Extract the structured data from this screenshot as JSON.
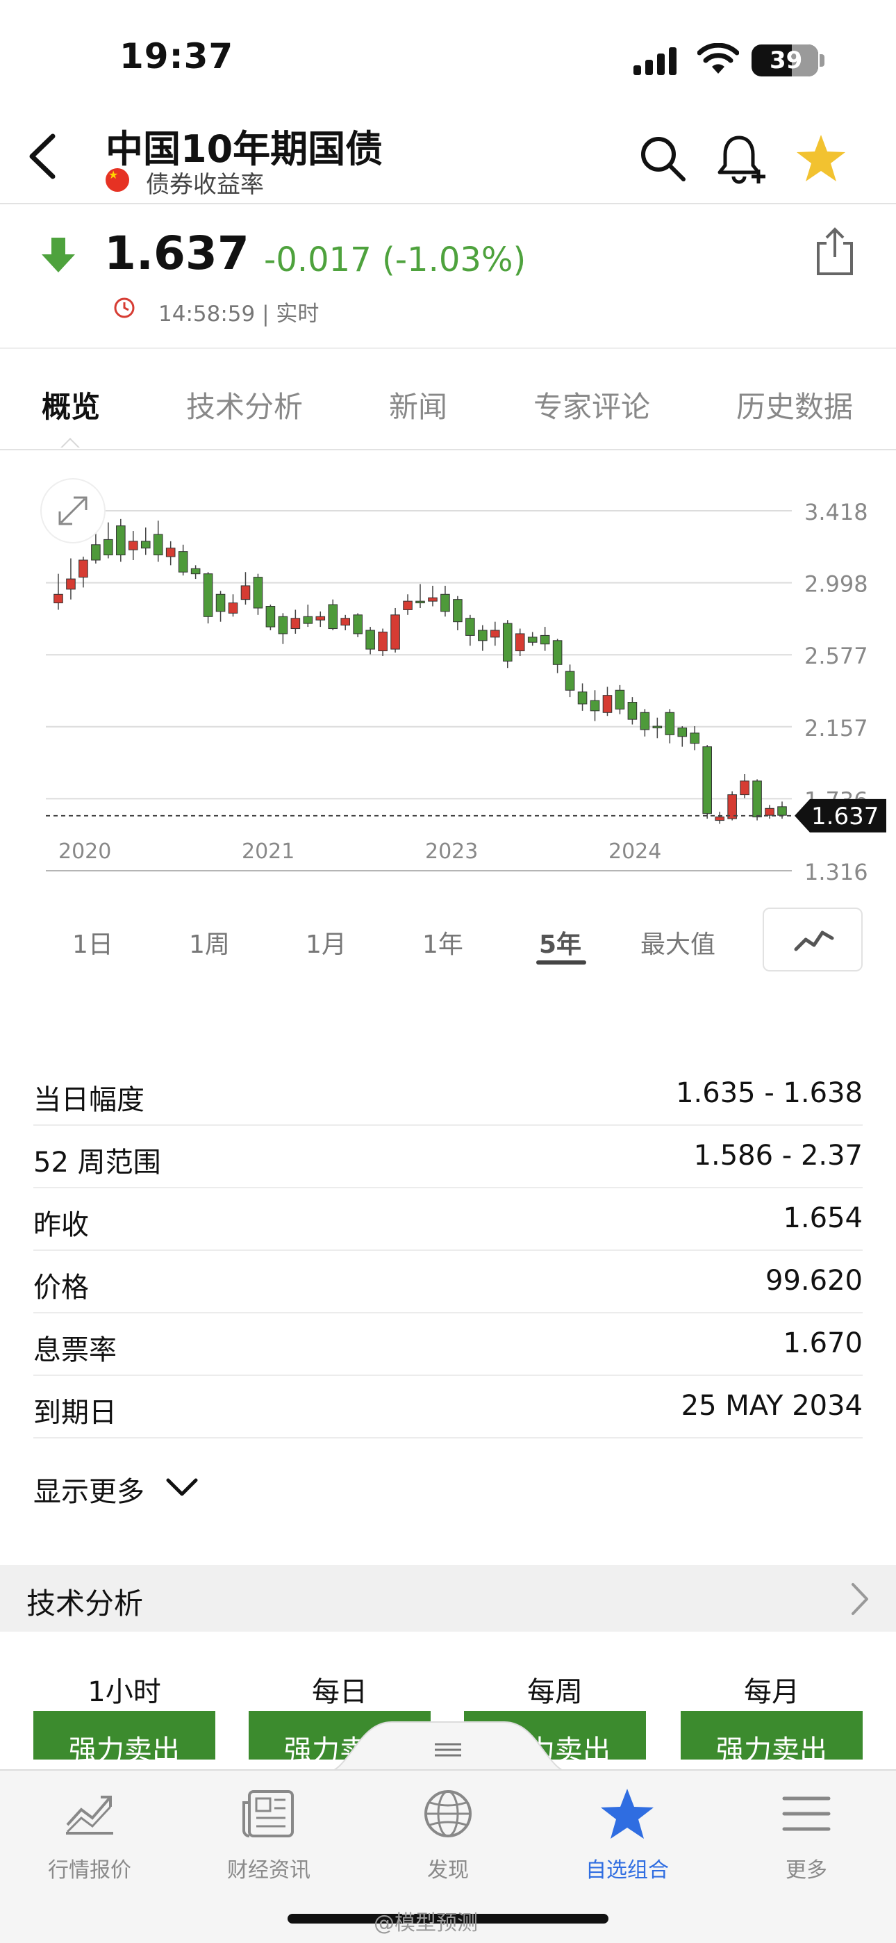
{
  "status_bar": {
    "time": "19:37",
    "battery": "39"
  },
  "header": {
    "title": "中国10年期国债",
    "subtitle": "债券收益率",
    "icons": [
      "chevron-left-icon",
      "search-icon",
      "bell-plus-icon",
      "star-icon"
    ],
    "star_color": "#f2c230"
  },
  "quote": {
    "price": "1.637",
    "change": "-0.017 (-1.03%)",
    "timestamp": "14:58:59 | 实时",
    "change_color": "#4ea23d"
  },
  "tabs": [
    {
      "label": "概览",
      "active": true
    },
    {
      "label": "技术分析",
      "active": false
    },
    {
      "label": "新闻",
      "active": false
    },
    {
      "label": "专家评论",
      "active": false
    },
    {
      "label": "历史数据",
      "active": false
    }
  ],
  "chart_data": {
    "type": "candlestick",
    "x_tick_labels": [
      "2020",
      "2021",
      "2023",
      "2024"
    ],
    "y_tick_labels": [
      "3.418",
      "2.998",
      "2.577",
      "2.157",
      "1.736",
      "1.316"
    ],
    "ylim": [
      1.316,
      3.418
    ],
    "current_value": 1.637,
    "current_label": "1.637",
    "up_color": "#d63c33",
    "down_color": "#4e9a3a",
    "candles": [
      {
        "o": 2.88,
        "h": 3.05,
        "l": 2.84,
        "c": 2.93
      },
      {
        "o": 2.96,
        "h": 3.14,
        "l": 2.9,
        "c": 3.02
      },
      {
        "o": 3.03,
        "h": 3.15,
        "l": 2.97,
        "c": 3.13
      },
      {
        "o": 3.22,
        "h": 3.32,
        "l": 3.11,
        "c": 3.13
      },
      {
        "o": 3.25,
        "h": 3.35,
        "l": 3.14,
        "c": 3.16
      },
      {
        "o": 3.33,
        "h": 3.37,
        "l": 3.12,
        "c": 3.16
      },
      {
        "o": 3.19,
        "h": 3.3,
        "l": 3.13,
        "c": 3.24
      },
      {
        "o": 3.24,
        "h": 3.32,
        "l": 3.16,
        "c": 3.2
      },
      {
        "o": 3.28,
        "h": 3.36,
        "l": 3.12,
        "c": 3.16
      },
      {
        "o": 3.15,
        "h": 3.24,
        "l": 3.1,
        "c": 3.2
      },
      {
        "o": 3.18,
        "h": 3.22,
        "l": 3.04,
        "c": 3.06
      },
      {
        "o": 3.08,
        "h": 3.1,
        "l": 3.02,
        "c": 3.05
      },
      {
        "o": 3.05,
        "h": 3.06,
        "l": 2.76,
        "c": 2.8
      },
      {
        "o": 2.93,
        "h": 2.95,
        "l": 2.77,
        "c": 2.83
      },
      {
        "o": 2.82,
        "h": 2.93,
        "l": 2.8,
        "c": 2.88
      },
      {
        "o": 2.9,
        "h": 3.06,
        "l": 2.87,
        "c": 2.98
      },
      {
        "o": 3.03,
        "h": 3.05,
        "l": 2.81,
        "c": 2.85
      },
      {
        "o": 2.86,
        "h": 2.87,
        "l": 2.72,
        "c": 2.74
      },
      {
        "o": 2.8,
        "h": 2.82,
        "l": 2.64,
        "c": 2.7
      },
      {
        "o": 2.73,
        "h": 2.84,
        "l": 2.7,
        "c": 2.79
      },
      {
        "o": 2.8,
        "h": 2.87,
        "l": 2.74,
        "c": 2.76
      },
      {
        "o": 2.78,
        "h": 2.83,
        "l": 2.74,
        "c": 2.8
      },
      {
        "o": 2.87,
        "h": 2.9,
        "l": 2.72,
        "c": 2.73
      },
      {
        "o": 2.75,
        "h": 2.81,
        "l": 2.72,
        "c": 2.79
      },
      {
        "o": 2.81,
        "h": 2.82,
        "l": 2.68,
        "c": 2.7
      },
      {
        "o": 2.72,
        "h": 2.74,
        "l": 2.58,
        "c": 2.61
      },
      {
        "o": 2.6,
        "h": 2.73,
        "l": 2.57,
        "c": 2.71
      },
      {
        "o": 2.61,
        "h": 2.85,
        "l": 2.59,
        "c": 2.81
      },
      {
        "o": 2.84,
        "h": 2.93,
        "l": 2.81,
        "c": 2.89
      },
      {
        "o": 2.89,
        "h": 2.99,
        "l": 2.85,
        "c": 2.88
      },
      {
        "o": 2.89,
        "h": 2.98,
        "l": 2.86,
        "c": 2.91
      },
      {
        "o": 2.93,
        "h": 2.98,
        "l": 2.8,
        "c": 2.83
      },
      {
        "o": 2.9,
        "h": 2.92,
        "l": 2.72,
        "c": 2.77
      },
      {
        "o": 2.79,
        "h": 2.81,
        "l": 2.63,
        "c": 2.69
      },
      {
        "o": 2.72,
        "h": 2.75,
        "l": 2.6,
        "c": 2.66
      },
      {
        "o": 2.68,
        "h": 2.77,
        "l": 2.63,
        "c": 2.72
      },
      {
        "o": 2.76,
        "h": 2.78,
        "l": 2.5,
        "c": 2.54
      },
      {
        "o": 2.6,
        "h": 2.73,
        "l": 2.57,
        "c": 2.7
      },
      {
        "o": 2.68,
        "h": 2.71,
        "l": 2.63,
        "c": 2.65
      },
      {
        "o": 2.69,
        "h": 2.74,
        "l": 2.6,
        "c": 2.64
      },
      {
        "o": 2.66,
        "h": 2.67,
        "l": 2.47,
        "c": 2.52
      },
      {
        "o": 2.48,
        "h": 2.52,
        "l": 2.33,
        "c": 2.37
      },
      {
        "o": 2.36,
        "h": 2.41,
        "l": 2.25,
        "c": 2.29
      },
      {
        "o": 2.31,
        "h": 2.37,
        "l": 2.19,
        "c": 2.25
      },
      {
        "o": 2.24,
        "h": 2.39,
        "l": 2.22,
        "c": 2.34
      },
      {
        "o": 2.37,
        "h": 2.4,
        "l": 2.23,
        "c": 2.26
      },
      {
        "o": 2.3,
        "h": 2.33,
        "l": 2.17,
        "c": 2.2
      },
      {
        "o": 2.24,
        "h": 2.26,
        "l": 2.1,
        "c": 2.14
      },
      {
        "o": 2.16,
        "h": 2.21,
        "l": 2.09,
        "c": 2.15
      },
      {
        "o": 2.24,
        "h": 2.26,
        "l": 2.06,
        "c": 2.11
      },
      {
        "o": 2.15,
        "h": 2.16,
        "l": 2.04,
        "c": 2.1
      },
      {
        "o": 2.12,
        "h": 2.16,
        "l": 2.02,
        "c": 2.06
      },
      {
        "o": 2.04,
        "h": 2.05,
        "l": 1.62,
        "c": 1.65
      },
      {
        "o": 1.61,
        "h": 1.66,
        "l": 1.59,
        "c": 1.63
      },
      {
        "o": 1.62,
        "h": 1.78,
        "l": 1.61,
        "c": 1.76
      },
      {
        "o": 1.76,
        "h": 1.88,
        "l": 1.74,
        "c": 1.84
      },
      {
        "o": 1.84,
        "h": 1.85,
        "l": 1.61,
        "c": 1.63
      },
      {
        "o": 1.64,
        "h": 1.7,
        "l": 1.62,
        "c": 1.68
      },
      {
        "o": 1.69,
        "h": 1.72,
        "l": 1.62,
        "c": 1.64
      }
    ]
  },
  "expand_icon": "expand-arrows-icon",
  "ranges": [
    {
      "label": "1日",
      "active": false
    },
    {
      "label": "1周",
      "active": false
    },
    {
      "label": "1月",
      "active": false
    },
    {
      "label": "1年",
      "active": false
    },
    {
      "label": "5年",
      "active": true
    },
    {
      "label": "最大值",
      "active": false
    }
  ],
  "stats": [
    {
      "label": "当日幅度",
      "value": "1.635 - 1.638"
    },
    {
      "label": "52 周范围",
      "value": "1.586 - 2.37"
    },
    {
      "label": "昨收",
      "value": "1.654"
    },
    {
      "label": "价格",
      "value": "99.620"
    },
    {
      "label": "息票率",
      "value": "1.670"
    },
    {
      "label": "到期日",
      "value": "25 MAY 2034"
    }
  ],
  "show_more": "显示更多",
  "technical": {
    "title": "技术分析",
    "timeframes": [
      {
        "label": "1小时",
        "signal": "强力卖出"
      },
      {
        "label": "每日",
        "signal": "强力卖出"
      },
      {
        "label": "每周",
        "signal": "强力卖出"
      },
      {
        "label": "每月",
        "signal": "强力卖出"
      }
    ]
  },
  "tabbar": [
    {
      "label": "行情报价",
      "icon": "chart-trend-icon",
      "active": false
    },
    {
      "label": "财经资讯",
      "icon": "newspaper-icon",
      "active": false
    },
    {
      "label": "发现",
      "icon": "globe-icon",
      "active": false
    },
    {
      "label": "自选组合",
      "icon": "star-icon",
      "active": true
    },
    {
      "label": "更多",
      "icon": "menu-icon",
      "active": false
    }
  ],
  "watermark": "@模型预测",
  "colors": {
    "accent_blue": "#2f6de1",
    "sell_green": "#3c8b2e"
  }
}
